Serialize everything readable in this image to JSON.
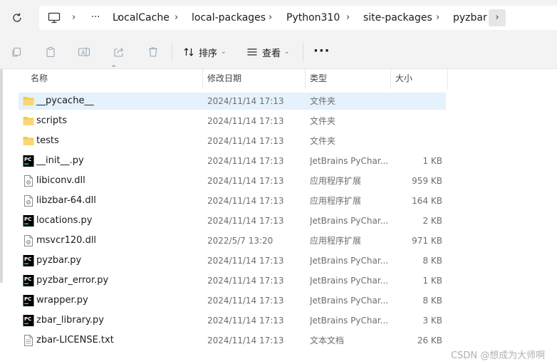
{
  "address": {
    "overflow_glyph": "···",
    "crumbs": [
      "LocalCache",
      "local-packages",
      "Python310",
      "site-packages",
      "pyzbar"
    ],
    "separator": "›",
    "more_glyph": "›"
  },
  "toolbar": {
    "sort_label": "排序",
    "view_label": "查看",
    "more_glyph": "···"
  },
  "columns": {
    "name": "名称",
    "date": "修改日期",
    "type": "类型",
    "size": "大小"
  },
  "files": [
    {
      "name": "__pycache__",
      "date": "2024/11/14 17:13",
      "type": "文件夹",
      "size": "",
      "icon": "folder-icon"
    },
    {
      "name": "scripts",
      "date": "2024/11/14 17:13",
      "type": "文件夹",
      "size": "",
      "icon": "folder-icon"
    },
    {
      "name": "tests",
      "date": "2024/11/14 17:13",
      "type": "文件夹",
      "size": "",
      "icon": "folder-icon"
    },
    {
      "name": "__init__.py",
      "date": "2024/11/14 17:13",
      "type": "JetBrains PyChar...",
      "size": "1 KB",
      "icon": "pycharm-file-icon"
    },
    {
      "name": "libiconv.dll",
      "date": "2024/11/14 17:13",
      "type": "应用程序扩展",
      "size": "959 KB",
      "icon": "dll-file-icon"
    },
    {
      "name": "libzbar-64.dll",
      "date": "2024/11/14 17:13",
      "type": "应用程序扩展",
      "size": "164 KB",
      "icon": "dll-file-icon"
    },
    {
      "name": "locations.py",
      "date": "2024/11/14 17:13",
      "type": "JetBrains PyChar...",
      "size": "2 KB",
      "icon": "pycharm-file-icon"
    },
    {
      "name": "msvcr120.dll",
      "date": "2022/5/7 13:20",
      "type": "应用程序扩展",
      "size": "971 KB",
      "icon": "dll-file-icon"
    },
    {
      "name": "pyzbar.py",
      "date": "2024/11/14 17:13",
      "type": "JetBrains PyChar...",
      "size": "8 KB",
      "icon": "pycharm-file-icon"
    },
    {
      "name": "pyzbar_error.py",
      "date": "2024/11/14 17:13",
      "type": "JetBrains PyChar...",
      "size": "1 KB",
      "icon": "pycharm-file-icon"
    },
    {
      "name": "wrapper.py",
      "date": "2024/11/14 17:13",
      "type": "JetBrains PyChar...",
      "size": "8 KB",
      "icon": "pycharm-file-icon"
    },
    {
      "name": "zbar_library.py",
      "date": "2024/11/14 17:13",
      "type": "JetBrains PyChar...",
      "size": "3 KB",
      "icon": "pycharm-file-icon"
    },
    {
      "name": "zbar-LICENSE.txt",
      "date": "2024/11/14 17:13",
      "type": "文本文档",
      "size": "26 KB",
      "icon": "text-file-icon"
    }
  ],
  "watermark": "CSDN @想成为大师啊",
  "colors": {
    "selection": "#e5f1fb",
    "folder": "#f2c94c",
    "pycharm_bg": "#000000",
    "pycharm_green": "#21d789"
  }
}
